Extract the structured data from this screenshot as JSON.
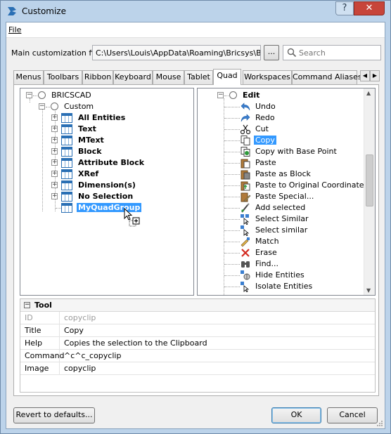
{
  "window": {
    "title": "Customize",
    "help_glyph": "?",
    "close_glyph": "✕"
  },
  "menu": {
    "file": "File"
  },
  "main_file": {
    "label": "Main customization file:",
    "path": "C:\\Users\\Louis\\AppData\\Roaming\\Bricsys\\Bricscad",
    "browse": "..."
  },
  "search": {
    "placeholder": "Search"
  },
  "tabs": [
    "Menus",
    "Toolbars",
    "Ribbon",
    "Keyboard",
    "Mouse",
    "Tablet",
    "Quad",
    "Workspaces",
    "Command Aliases"
  ],
  "active_tab": "Quad",
  "left_tree": {
    "root": "BRICSCAD",
    "custom": "Custom",
    "groups": [
      "All Entities",
      "Text",
      "MText",
      "Block",
      "Attribute Block",
      "XRef",
      "Dimension(s)",
      "No Selection"
    ],
    "new_group": "MyQuadGroup"
  },
  "right_tree": {
    "root": "Edit",
    "items": [
      {
        "label": "Undo",
        "icon": "undo-icon"
      },
      {
        "label": "Redo",
        "icon": "redo-icon"
      },
      {
        "label": "Cut",
        "icon": "scissors-icon"
      },
      {
        "label": "Copy",
        "icon": "copy-icon"
      },
      {
        "label": "Copy with Base Point",
        "icon": "copy-base-icon"
      },
      {
        "label": "Paste",
        "icon": "paste-icon"
      },
      {
        "label": "Paste as Block",
        "icon": "paste-block-icon"
      },
      {
        "label": "Paste to Original Coordinates",
        "icon": "paste-orig-icon"
      },
      {
        "label": "Paste Special...",
        "icon": "paste-special-icon"
      },
      {
        "label": "Add selected",
        "icon": "add-selected-icon"
      },
      {
        "label": "Select Similar",
        "icon": "select-similar-icon"
      },
      {
        "label": "Select similar",
        "icon": "select-similar-icon"
      },
      {
        "label": "Match",
        "icon": "match-icon"
      },
      {
        "label": "Erase",
        "icon": "erase-icon"
      },
      {
        "label": "Find...",
        "icon": "find-icon"
      },
      {
        "label": "Hide Entities",
        "icon": "hide-icon"
      },
      {
        "label": "Isolate Entities",
        "icon": "isolate-icon"
      }
    ],
    "selected": "Copy"
  },
  "properties": {
    "section": "Tool",
    "rows": [
      {
        "key": "ID",
        "value": "copyclip"
      },
      {
        "key": "Title",
        "value": "Copy"
      },
      {
        "key": "Help",
        "value": "Copies the selection to the Clipboard"
      },
      {
        "key": "Command",
        "value": "^c^c_copyclip"
      },
      {
        "key": "Image",
        "value": "copyclip"
      }
    ]
  },
  "buttons": {
    "revert": "Revert to defaults...",
    "ok": "OK",
    "cancel": "Cancel"
  },
  "colors": {
    "selection": "#3399ff",
    "titlebar": "#bcd3ea",
    "close": "#c7453a",
    "icon_blue": "#2a6fb4"
  }
}
